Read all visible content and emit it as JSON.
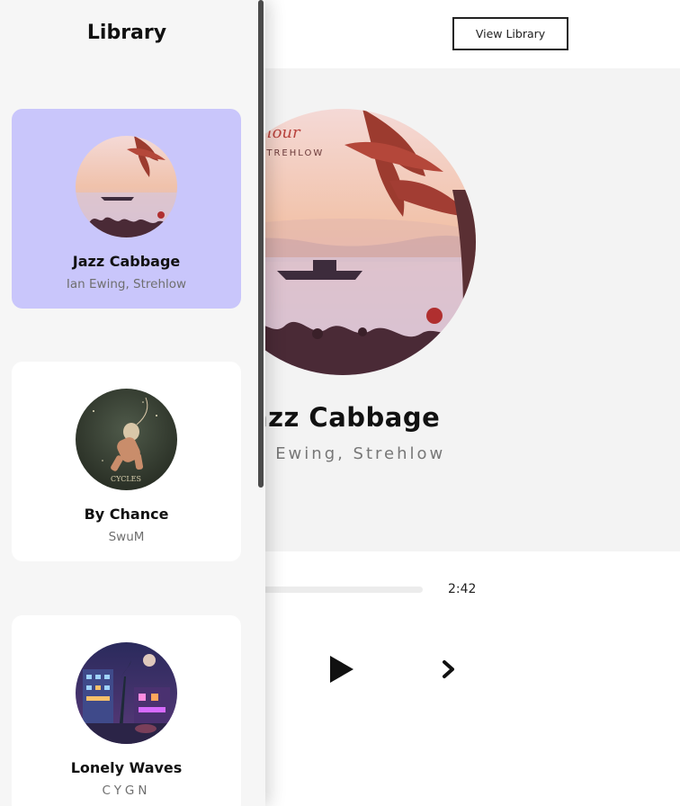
{
  "header": {
    "view_library_label": "View Library"
  },
  "now_playing": {
    "title": "Jazz Cabbage",
    "artist": "Ian Ewing, Strehlow",
    "cover_text": {
      "line1": "hour",
      "line2": "STREHLOW"
    },
    "end_time": "2:42"
  },
  "library": {
    "title": "Library",
    "songs": [
      {
        "name": "Jazz Cabbage",
        "artist": "Ian Ewing, Strehlow",
        "selected": true
      },
      {
        "name": "By Chance",
        "artist": "SwuM",
        "cover_text": "CYCLES",
        "selected": false
      },
      {
        "name": "Lonely Waves",
        "artist": "CYGN",
        "selected": false
      }
    ]
  },
  "icons": {
    "play": "play-icon",
    "next": "chevron-right-icon"
  },
  "colors": {
    "selected_card": "#c9c6fb",
    "text": "#111111",
    "muted": "#777777"
  }
}
